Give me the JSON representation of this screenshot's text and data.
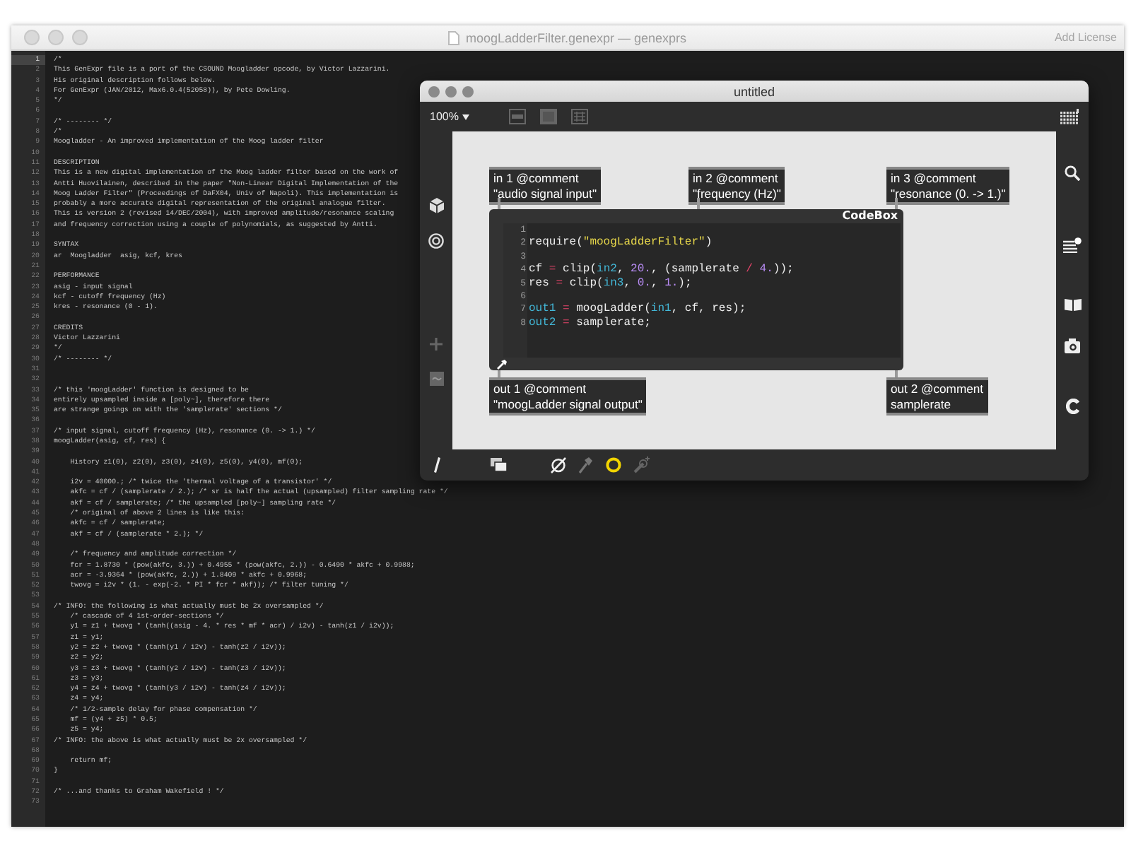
{
  "window": {
    "title": "moogLadderFilter.genexpr — genexprs",
    "action": "Add License"
  },
  "editor": {
    "lines": [
      {
        "number": "1",
        "text": "/*",
        "current": true
      },
      {
        "number": "2",
        "text": "This GenExpr file is a port of the CSOUND Moogladder opcode, by Victor Lazzarini.",
        "current": false
      },
      {
        "number": "3",
        "text": "His original description follows below.",
        "current": false
      },
      {
        "number": "4",
        "text": "For GenExpr (JAN/2012, Max6.0.4(52058)), by Pete Dowling.",
        "current": false
      },
      {
        "number": "5",
        "text": "*/",
        "current": false
      },
      {
        "number": "6",
        "current": false
      },
      {
        "number": "7",
        "text": "/* -------- */",
        "current": false
      },
      {
        "number": "8",
        "text": "/*",
        "current": false
      },
      {
        "number": "9",
        "text": "Moogladder - An improved implementation of the Moog ladder filter",
        "current": false
      },
      {
        "number": "10",
        "current": false
      },
      {
        "number": "11",
        "text": "DESCRIPTION",
        "current": false
      },
      {
        "number": "12",
        "text": "This is a new digital implementation of the Moog ladder filter based on the work of",
        "current": false
      },
      {
        "number": "13",
        "text": "Antti Huovilainen, described in the paper \"Non-Linear Digital Implementation of the",
        "current": false
      },
      {
        "number": "14",
        "text": "Moog Ladder Filter\" (Proceedings of DaFX04, Univ of Napoli). This implementation is",
        "current": false
      },
      {
        "number": "15",
        "text": "probably a more accurate digital representation of the original analogue filter.",
        "current": false
      },
      {
        "number": "16",
        "text": "This is version 2 (revised 14/DEC/2004), with improved amplitude/resonance scaling",
        "current": false
      },
      {
        "number": "17",
        "text": "and frequency correction using a couple of polynomials, as suggested by Antti.",
        "current": false
      },
      {
        "number": "18",
        "current": false
      },
      {
        "number": "19",
        "text": "SYNTAX",
        "current": false
      },
      {
        "number": "20",
        "text": "ar  Moogladder  asig, kcf, kres",
        "current": false
      },
      {
        "number": "21",
        "current": false
      },
      {
        "number": "22",
        "text": "PERFORMANCE",
        "current": false
      },
      {
        "number": "23",
        "text": "asig - input signal",
        "current": false
      },
      {
        "number": "24",
        "text": "kcf - cutoff frequency (Hz)",
        "current": false
      },
      {
        "number": "25",
        "text": "kres - resonance (0 - 1).",
        "current": false
      },
      {
        "number": "26",
        "current": false
      },
      {
        "number": "27",
        "text": "CREDITS",
        "current": false
      },
      {
        "number": "28",
        "text": "Victor Lazzarini",
        "current": false
      },
      {
        "number": "29",
        "text": "*/",
        "current": false
      },
      {
        "number": "30",
        "text": "/* -------- */",
        "current": false
      },
      {
        "number": "31",
        "current": false
      },
      {
        "number": "32",
        "current": false
      },
      {
        "number": "33",
        "text": "/* this 'moogLadder' function is designed to be",
        "current": false
      },
      {
        "number": "34",
        "text": "entirely upsampled inside a [poly~], therefore there",
        "current": false
      },
      {
        "number": "35",
        "text": "are strange goings on with the 'samplerate' sections */",
        "current": false
      },
      {
        "number": "36",
        "current": false
      },
      {
        "number": "37",
        "text": "/* input signal, cutoff frequency (Hz), resonance (0. -> 1.) */",
        "current": false
      },
      {
        "number": "38",
        "text": "moogLadder(asig, cf, res) {",
        "current": false
      },
      {
        "number": "39",
        "current": false
      },
      {
        "number": "40",
        "text": "    History z1(0), z2(0), z3(0), z4(0), z5(0), y4(0), mf(0);",
        "current": false
      },
      {
        "number": "41",
        "current": false
      },
      {
        "number": "42",
        "text": "    i2v = 40000.; /* twice the 'thermal voltage of a transistor' */",
        "current": false
      },
      {
        "number": "43",
        "text": "    akfc = cf / (samplerate / 2.); /* sr is half the actual (upsampled) filter sampling rate */",
        "current": false
      },
      {
        "number": "44",
        "text": "    akf = cf / samplerate; /* the upsampled [poly~] sampling rate */",
        "current": false
      },
      {
        "number": "45",
        "text": "    /* original of above 2 lines is like this:",
        "current": false
      },
      {
        "number": "46",
        "text": "    akfc = cf / samplerate;",
        "current": false
      },
      {
        "number": "47",
        "text": "    akf = cf / (samplerate * 2.); */",
        "current": false
      },
      {
        "number": "48",
        "current": false
      },
      {
        "number": "49",
        "text": "    /* frequency and amplitude correction */",
        "current": false
      },
      {
        "number": "50",
        "text": "    fcr = 1.8730 * (pow(akfc, 3.)) + 0.4955 * (pow(akfc, 2.)) - 0.6490 * akfc + 0.9988;",
        "current": false
      },
      {
        "number": "51",
        "text": "    acr = -3.9364 * (pow(akfc, 2.)) + 1.8409 * akfc + 0.9968;",
        "current": false
      },
      {
        "number": "52",
        "text": "    twovg = i2v * (1. - exp(-2. * PI * fcr * akf)); /* filter tuning */",
        "current": false
      },
      {
        "number": "53",
        "current": false
      },
      {
        "number": "54",
        "text": "/* INFO: the following is what actually must be 2x oversampled */",
        "current": false
      },
      {
        "number": "55",
        "text": "    /* cascade of 4 1st-order-sections */",
        "current": false
      },
      {
        "number": "56",
        "text": "    y1 = z1 + twovg * (tanh((asig - 4. * res * mf * acr) / i2v) - tanh(z1 / i2v));",
        "current": false
      },
      {
        "number": "57",
        "text": "    z1 = y1;",
        "current": false
      },
      {
        "number": "58",
        "text": "    y2 = z2 + twovg * (tanh(y1 / i2v) - tanh(z2 / i2v));",
        "current": false
      },
      {
        "number": "59",
        "text": "    z2 = y2;",
        "current": false
      },
      {
        "number": "60",
        "text": "    y3 = z3 + twovg * (tanh(y2 / i2v) - tanh(z3 / i2v));",
        "current": false
      },
      {
        "number": "61",
        "text": "    z3 = y3;",
        "current": false
      },
      {
        "number": "62",
        "text": "    y4 = z4 + twovg * (tanh(y3 / i2v) - tanh(z4 / i2v));",
        "current": false
      },
      {
        "number": "63",
        "text": "    z4 = y4;",
        "current": false
      },
      {
        "number": "64",
        "text": "    /* 1/2-sample delay for phase compensation */",
        "current": false
      },
      {
        "number": "65",
        "text": "    mf = (y4 + z5) * 0.5;",
        "current": false
      },
      {
        "number": "66",
        "text": "    z5 = y4;",
        "current": false
      },
      {
        "number": "67",
        "text": "/* INFO: the above is what actually must be 2x oversampled */",
        "current": false
      },
      {
        "number": "68",
        "current": false
      },
      {
        "number": "69",
        "text": "    return mf;",
        "current": false
      },
      {
        "number": "70",
        "text": "}",
        "current": false
      },
      {
        "number": "71",
        "current": false
      },
      {
        "number": "72",
        "text": "/* ...and thanks to Graham Wakefield ! */",
        "current": false
      },
      {
        "number": "73",
        "current": false
      }
    ]
  },
  "patcher": {
    "title": "untitled",
    "zoom": "100%",
    "comments": [
      {
        "kind": "inlet",
        "text": "in 1 @comment\n\"audio signal input\""
      },
      {
        "kind": "inlet",
        "text": "in 2 @comment\n\"frequency (Hz)\""
      },
      {
        "kind": "inlet",
        "text": "in 3 @comment\n\"resonance (0. -> 1.)\""
      },
      {
        "kind": "outlet",
        "text": "out 1 @comment\n\"moogLadder signal output\""
      },
      {
        "kind": "outlet",
        "text": "out 2 @comment\nsamplerate"
      }
    ],
    "codebox": {
      "title": "CodeBox",
      "lines": [
        {
          "number": "1"
        },
        {
          "number": "2",
          "tokens": [
            {
              "kind": "plain",
              "text": "require("
            },
            {
              "kind": "string",
              "text": "\"moogLadderFilter\""
            },
            {
              "kind": "plain",
              "text": ")"
            }
          ]
        },
        {
          "number": "3"
        },
        {
          "number": "4",
          "tokens": [
            {
              "kind": "plain",
              "text": "cf "
            },
            {
              "kind": "operator",
              "text": "="
            },
            {
              "kind": "plain",
              "text": " clip("
            },
            {
              "kind": "io",
              "text": "in2"
            },
            {
              "kind": "plain",
              "text": ", "
            },
            {
              "kind": "number",
              "text": "20."
            },
            {
              "kind": "plain",
              "text": ", (samplerate"
            },
            {
              "kind": "operator",
              "text": " / "
            },
            {
              "kind": "number",
              "text": "4."
            },
            {
              "kind": "plain",
              "text": "));"
            }
          ]
        },
        {
          "number": "5",
          "tokens": [
            {
              "kind": "plain",
              "text": "res "
            },
            {
              "kind": "operator",
              "text": "="
            },
            {
              "kind": "plain",
              "text": " clip("
            },
            {
              "kind": "io",
              "text": "in3"
            },
            {
              "kind": "plain",
              "text": ", "
            },
            {
              "kind": "number",
              "text": "0."
            },
            {
              "kind": "plain",
              "text": ", "
            },
            {
              "kind": "number",
              "text": "1."
            },
            {
              "kind": "plain",
              "text": ");"
            }
          ]
        },
        {
          "number": "6"
        },
        {
          "number": "7",
          "tokens": [
            {
              "kind": "io",
              "text": "out1"
            },
            {
              "kind": "operator",
              "text": " ="
            },
            {
              "kind": "plain",
              "text": " moogLadder("
            },
            {
              "kind": "io",
              "text": "in1"
            },
            {
              "kind": "plain",
              "text": ", cf, res);"
            }
          ]
        },
        {
          "number": "8",
          "tokens": [
            {
              "kind": "io",
              "text": "out2"
            },
            {
              "kind": "operator",
              "text": " ="
            },
            {
              "kind": "plain",
              "text": " samplerate;"
            }
          ]
        }
      ]
    }
  }
}
